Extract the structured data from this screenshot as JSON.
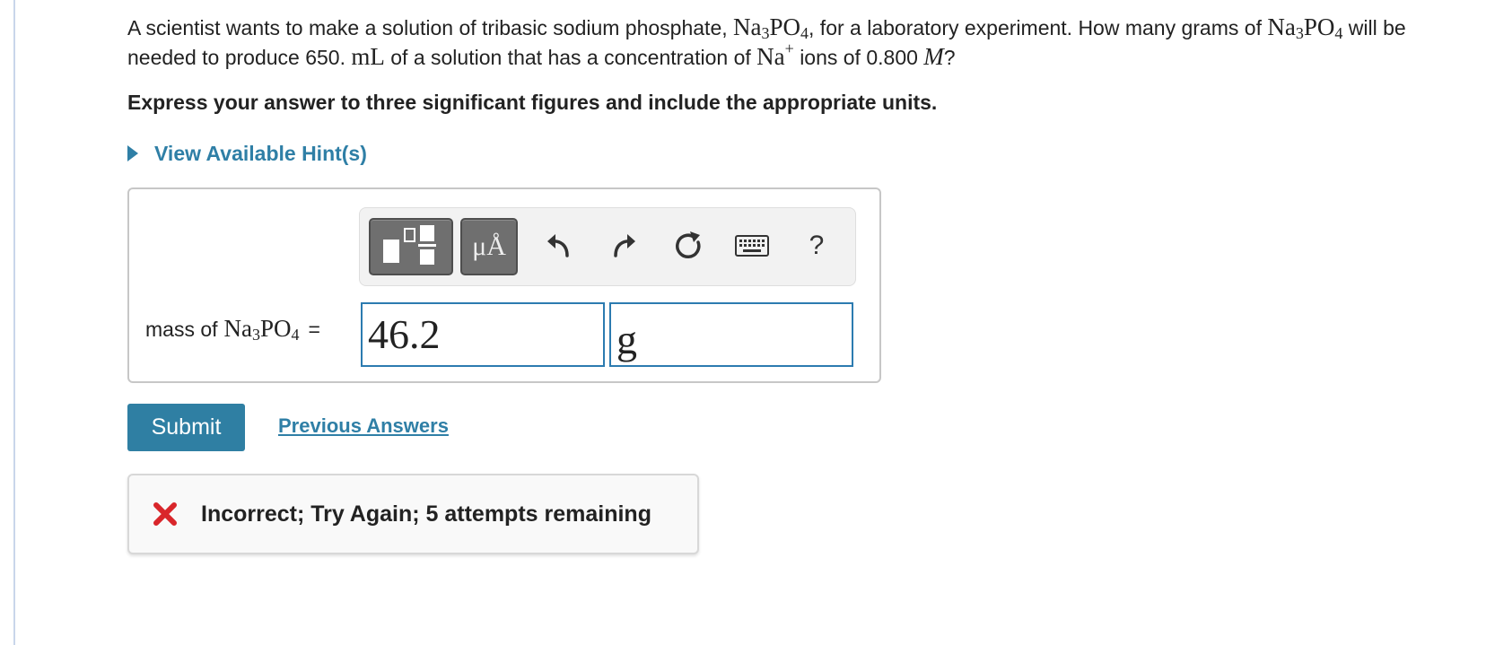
{
  "question": {
    "part1": "A scientist wants to make a solution of tribasic sodium phosphate,",
    "formula_na": "Na",
    "formula_3": "3",
    "formula_po": "PO",
    "formula_4": "4",
    "part2": ", for a laboratory experiment. How many grams of",
    "part3": "will be needed to produce 650.",
    "unit_ml": "mL",
    "part4": "of a solution that has a concentration of",
    "ion_na": "Na",
    "ion_plus": "+",
    "part5": "ions of 0.800",
    "molar": "M",
    "qmark": "?"
  },
  "instruction": "Express your answer to three significant figures and include the appropriate units.",
  "hint_label": "View Available Hint(s)",
  "toolbar": {
    "units_label": "μÅ",
    "help_label": "?",
    "icons": [
      "templates-icon",
      "units-icon",
      "undo-icon",
      "redo-icon",
      "reset-icon",
      "keyboard-icon",
      "help-icon"
    ]
  },
  "answer": {
    "label_prefix": "mass of",
    "equals": "=",
    "value": "46.2",
    "unit": "g"
  },
  "submit_label": "Submit",
  "previous_answers_label": "Previous Answers",
  "feedback": {
    "text": "Incorrect; Try Again; 5 attempts remaining",
    "status": "incorrect"
  },
  "colors": {
    "accent": "#2f7fa6",
    "submit_bg": "#2f7fa3",
    "input_border": "#2c7bb0",
    "error": "#d9262b"
  }
}
